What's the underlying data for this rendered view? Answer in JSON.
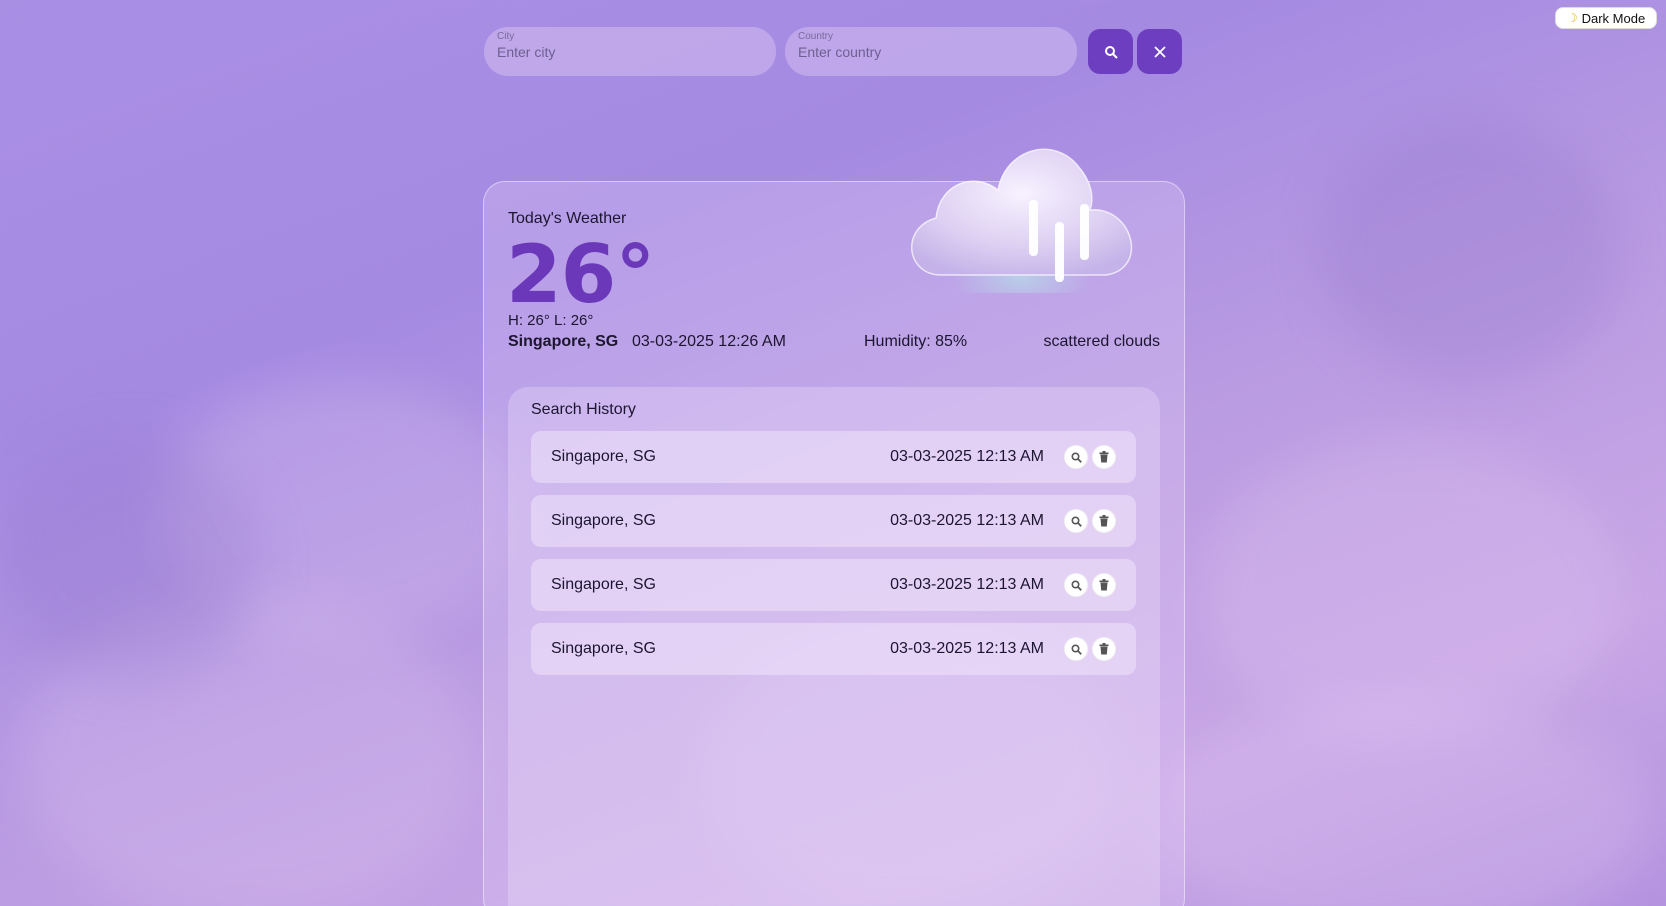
{
  "header": {
    "mode_toggle_label": "Dark Mode"
  },
  "search": {
    "city_label": "City",
    "city_placeholder": "Enter city",
    "city_value": "",
    "country_label": "Country",
    "country_placeholder": "Enter country",
    "country_value": "",
    "search_icon": "search-icon",
    "clear_icon": "close-icon"
  },
  "weather": {
    "title": "Today's Weather",
    "temperature": "26°",
    "hilo": "H: 26° L: 26°",
    "location": "Singapore, SG",
    "datetime": "03-03-2025 12:26 AM",
    "humidity": "Humidity: 85%",
    "description": "scattered clouds",
    "icon": "rain-cloud-icon"
  },
  "history": {
    "title": "Search History",
    "items": [
      {
        "location": "Singapore, SG",
        "datetime": "03-03-2025 12:13 AM"
      },
      {
        "location": "Singapore, SG",
        "datetime": "03-03-2025 12:13 AM"
      },
      {
        "location": "Singapore, SG",
        "datetime": "03-03-2025 12:13 AM"
      },
      {
        "location": "Singapore, SG",
        "datetime": "03-03-2025 12:13 AM"
      }
    ]
  },
  "colors": {
    "accent": "#6d3fc0",
    "temperature": "#6a38b8",
    "background": "#a98fe4"
  }
}
